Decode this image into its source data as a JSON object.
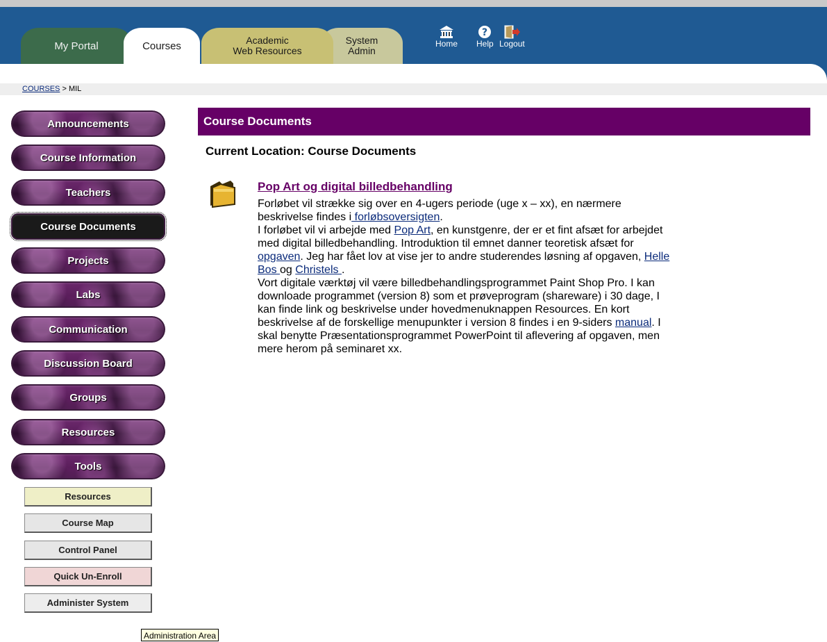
{
  "header": {
    "tabs": {
      "my_portal": "My Portal",
      "courses": "Courses",
      "academic_line1": "Academic",
      "academic_line2": "Web Resources",
      "sysadmin_line1": "System",
      "sysadmin_line2": "Admin"
    },
    "icons": {
      "home": "Home",
      "help": "Help",
      "logout": "Logout"
    }
  },
  "breadcrumb": {
    "link": "COURSES",
    "separator": " > ",
    "current": "MIL"
  },
  "sidebar": {
    "items": [
      "Announcements",
      "Course Information",
      "Teachers",
      "Course Documents",
      "Projects",
      "Labs",
      "Communication",
      "Discussion Board",
      "Groups",
      "Resources",
      "Tools"
    ],
    "active": "Course Documents",
    "admin_buttons": [
      "Resources",
      "Course Map",
      "Control Panel",
      "Quick Un-Enroll",
      "Administer System"
    ],
    "tooltip": "Administration Area"
  },
  "content": {
    "header": "Course Documents",
    "current_location": "Current Location: Course Documents",
    "item_title": "Pop Art og digital billedbehandling",
    "body": {
      "l1": "Forløbet vil strække sig over en 4-ugers periode (uge x – xx), en nærmere",
      "l2a": "beskrivelse findes i",
      "l2_link": " forløbsoversigten",
      "l2b": ".",
      "l3a": "I forløbet vil vi arbejde med ",
      "l3_link": "Pop Art",
      "l3b": ", en kunstgenre, der er et fint afsæt for arbejdet",
      "l4": "med digital billedbehandling. Introduktion til emnet danner teoretisk afsæt for",
      "l5_link1": "opgaven",
      "l5a": ". Jeg har fået lov at vise jer to andre studerendes løsning af opgaven, ",
      "l5_link2": "Helle",
      "l6_link1": "Bos ",
      "l6a": "og ",
      "l6_link2": "Christels ",
      "l6b": ".",
      "l7": "Vort digitale værktøj vil være billedbehandlingsprogrammet Paint Shop Pro. I kan",
      "l8": "downloade programmet (version 8) som et prøveprogram (shareware) i 30 dage, I",
      "l9": "kan finde link og beskrivelse under hovedmenuknappen Resources. En kort",
      "l10a": "beskrivelse af de forskellige menupunkter i version 8 findes i en 9-siders ",
      "l10_link": "manual",
      "l10b": ". I",
      "l11": "skal benytte Præsentationsprogrammet PowerPoint til aflevering af opgaven, men",
      "l12": "mere herom på seminaret xx."
    }
  },
  "colors": {
    "header_blue": "#1f5a93",
    "course_purple": "#660066",
    "link_blue": "#0a2a7a"
  }
}
